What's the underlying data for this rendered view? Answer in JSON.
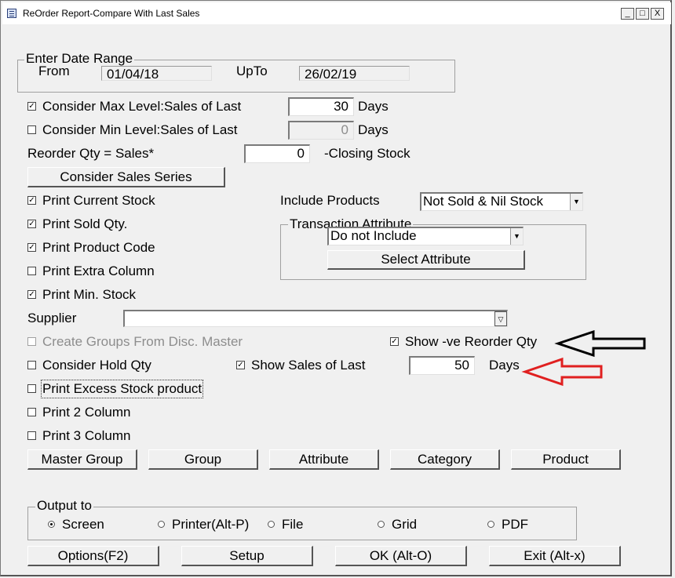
{
  "window": {
    "title": "ReOrder Report-Compare With Last Sales",
    "icon": "document-icon"
  },
  "titlebar_buttons": {
    "minimize": "_",
    "maximize": "□",
    "close": "X"
  },
  "date_range": {
    "group_title": "Enter Date Range",
    "from_label": "From",
    "from_value": "01/04/18",
    "upto_label": "UpTo",
    "upto_value": "26/02/19"
  },
  "options": {
    "max_level": {
      "label": "Consider Max Level:Sales of Last",
      "checked": true,
      "value": "30",
      "unit": "Days"
    },
    "min_level": {
      "label": "Consider Min Level:Sales of Last",
      "checked": false,
      "value": "0",
      "unit": "Days"
    },
    "reorder_qty": {
      "label": "Reorder Qty = Sales*",
      "value": "0",
      "suffix": "-Closing Stock"
    },
    "consider_sales_series": "Consider Sales Series",
    "print_current_stock": {
      "label": "Print Current Stock",
      "checked": true
    },
    "print_sold_qty": {
      "label": "Print Sold Qty.",
      "checked": true
    },
    "print_product_code": {
      "label": "Print Product Code",
      "checked": true
    },
    "print_extra_column": {
      "label": "Print Extra Column",
      "checked": false
    },
    "print_min_stock": {
      "label": "Print Min. Stock",
      "checked": true
    },
    "supplier": {
      "label": "Supplier",
      "value": ""
    },
    "create_groups": {
      "label": "Create Groups From Disc. Master",
      "checked": false
    },
    "show_ve_reorder": {
      "label": "Show -ve Reorder Qty",
      "checked": true
    },
    "consider_hold_qty": {
      "label": "Consider Hold Qty",
      "checked": false
    },
    "show_sales_of_last": {
      "label": "Show Sales of Last",
      "checked": true,
      "value": "50",
      "unit": "Days"
    },
    "print_excess_stock": {
      "label": "Print Excess Stock product",
      "checked": false
    },
    "print_2_column": {
      "label": "Print 2 Column",
      "checked": false
    },
    "print_3_column": {
      "label": "Print 3 Column",
      "checked": false
    }
  },
  "include_products": {
    "label": "Include Products",
    "value": "Not Sold & Nil Stock"
  },
  "transaction_attribute": {
    "group_title": "Transaction Attribute",
    "value": "Do not Include",
    "button": "Select Attribute"
  },
  "filter_buttons": {
    "master_group": "Master Group",
    "group": "Group",
    "attribute": "Attribute",
    "category": "Category",
    "product": "Product"
  },
  "output": {
    "group_title": "Output to",
    "screen": "Screen",
    "printer": "Printer(Alt-P)",
    "file": "File",
    "grid": "Grid",
    "pdf": "PDF",
    "selected": "Screen"
  },
  "bottom_buttons": {
    "options": "Options(F2)",
    "setup": "Setup",
    "ok": "OK (Alt-O)",
    "exit": "Exit (Alt-x)"
  },
  "colors": {
    "annotation_black": "#000000",
    "annotation_red": "#e02020",
    "background": "#f0f0f0"
  }
}
